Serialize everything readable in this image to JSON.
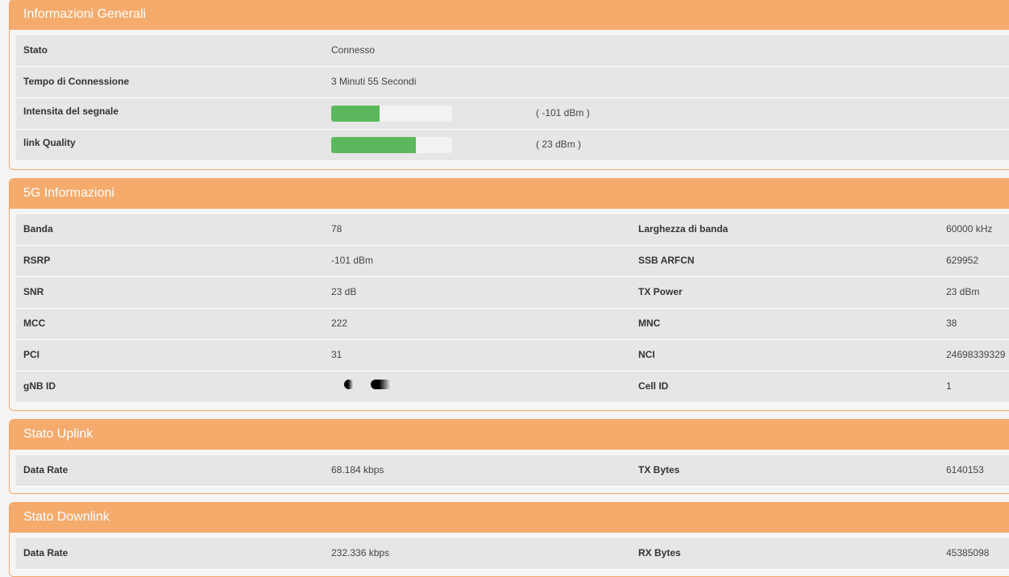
{
  "general": {
    "title": "Informazioni Generali",
    "rows": [
      {
        "label": "Stato",
        "value": "Connesso"
      },
      {
        "label": "Tempo di Connessione",
        "value": "3 Minuti 55 Secondi"
      },
      {
        "label": "Intensita del segnale",
        "bar_percent": 40,
        "extra": "( -101 dBm )"
      },
      {
        "label": "link Quality",
        "bar_percent": 70,
        "extra": "( 23 dBm )"
      }
    ]
  },
  "fiveg": {
    "title": "5G Informazioni",
    "rows": [
      {
        "label": "Banda",
        "value": "78",
        "label2": "Larghezza di banda",
        "value2": "60000 kHz"
      },
      {
        "label": "RSRP",
        "value": "-101 dBm",
        "label2": "SSB ARFCN",
        "value2": "629952"
      },
      {
        "label": "SNR",
        "value": "23 dB",
        "label2": "TX Power",
        "value2": "23 dBm"
      },
      {
        "label": "MCC",
        "value": "222",
        "label2": "MNC",
        "value2": "38"
      },
      {
        "label": "PCI",
        "value": "31",
        "label2": "NCI",
        "value2": "24698339329"
      },
      {
        "label": "gNB ID",
        "label2": "Cell ID",
        "value2": "1"
      }
    ]
  },
  "uplink": {
    "title": "Stato Uplink",
    "rows": [
      {
        "label": "Data Rate",
        "value": "68.184 kbps",
        "label2": "TX Bytes",
        "value2": "6140153"
      }
    ]
  },
  "downlink": {
    "title": "Stato Downlink",
    "rows": [
      {
        "label": "Data Rate",
        "value": "232.336 kbps",
        "label2": "RX Bytes",
        "value2": "45385098"
      }
    ]
  },
  "colors": {
    "header": "#f4ab6c",
    "bar": "#5cb85c"
  }
}
